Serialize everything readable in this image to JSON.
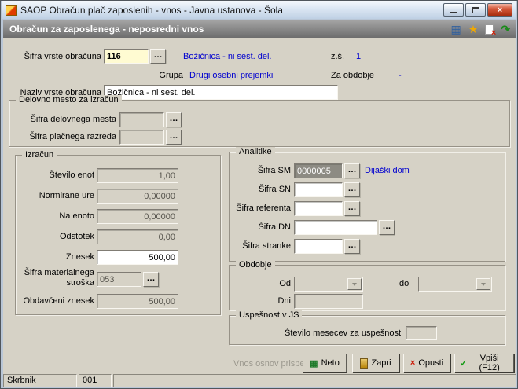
{
  "window": {
    "title": "SAOP Obračun plač zaposlenih - vnos - Javna ustanova - Šola"
  },
  "header": {
    "title": "Obračun za zaposlenega - neposredni vnos"
  },
  "form": {
    "sifra_vrste": {
      "label": "Šifra vrste obračuna",
      "value": "116",
      "name": "Božičnica - ni sest. del."
    },
    "zs": {
      "label": "z.š.",
      "value": "1"
    },
    "grupa": {
      "label": "Grupa",
      "value": "Drugi osebni prejemki"
    },
    "za_obdobje": {
      "label": "Za obdobje",
      "value": "-"
    },
    "naziv": {
      "label": "Naziv vrste obračuna",
      "value": "Božičnica - ni sest. del."
    }
  },
  "delovno_mesto": {
    "title": "Delovno mesto za izračun",
    "sifra_delovnega_mesta": {
      "label": "Šifra delovnega mesta",
      "value": ""
    },
    "sifra_placnega_razreda": {
      "label": "Šifra plačnega razreda",
      "value": ""
    }
  },
  "izracun": {
    "title": "Izračun",
    "stevilo_enot": {
      "label": "Število enot",
      "value": "1,00"
    },
    "normirane_ure": {
      "label": "Normirane ure",
      "value": "0,00000"
    },
    "na_enoto": {
      "label": "Na enoto",
      "value": "0,00000"
    },
    "odstotek": {
      "label": "Odstotek",
      "value": "0,00"
    },
    "znesek": {
      "label": "Znesek",
      "value": "500,00"
    },
    "sifra_materialnega_stroska": {
      "label": "Šifra materialnega stroška",
      "value": "053"
    },
    "obdavceni_znesek": {
      "label": "Obdavčeni znesek",
      "value": "500,00"
    }
  },
  "analitike": {
    "title": "Analitike",
    "sifra_sm": {
      "label": "Šifra SM",
      "value": "0000005",
      "name": "Dijaški dom"
    },
    "sifra_sn": {
      "label": "Šifra SN",
      "value": ""
    },
    "sifra_referenta": {
      "label": "Šifra referenta",
      "value": ""
    },
    "sifra_dn": {
      "label": "Šifra DN",
      "value": ""
    },
    "sifra_stranke": {
      "label": "Šifra stranke",
      "value": ""
    }
  },
  "obdobje": {
    "title": "Obdobje",
    "od": {
      "label": "Od",
      "value": ""
    },
    "do": {
      "label": "do",
      "value": ""
    },
    "dni": {
      "label": "Dni",
      "value": ""
    }
  },
  "uspesnost": {
    "title": "Uspešnost v JS",
    "stevilo_mesecev": {
      "label": "Število mesecev za uspešnost",
      "value": ""
    }
  },
  "footer": {
    "note": "Vnos osnov prispevkov",
    "neto": "Neto",
    "zapri": "Zapri",
    "opusti": "Opusti",
    "vpisi": "Vpiši (F12)"
  },
  "statusbar": {
    "user": "Skrbnik",
    "code": "001"
  },
  "icons": {
    "ellipsis": "…",
    "table": "▦",
    "star": "★",
    "cross": "×",
    "exit": "↷",
    "check": "✓"
  },
  "colors": {
    "accent_blue": "#0000cf",
    "input_yellow": "#fffbd2",
    "dialog_bg": "#d6d2c6"
  }
}
